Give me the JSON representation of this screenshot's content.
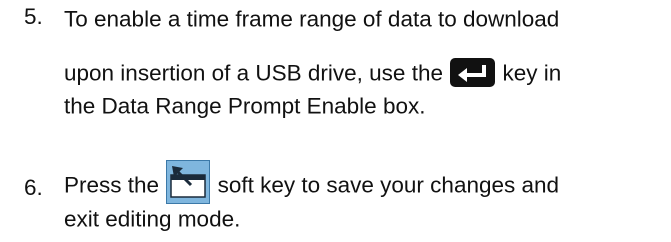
{
  "steps": [
    {
      "number": "5.",
      "line1": "To enable a time frame range of data to download",
      "line2_before": "upon insertion of a USB drive, use the",
      "line2_after": "key in",
      "line3": "the Data Range Prompt Enable box.",
      "icon": "enter-key-icon"
    },
    {
      "number": "6.",
      "line1_before": "Press the",
      "line1_after": "soft key to save your changes and",
      "line2": "exit editing mode.",
      "icon": "save-exit-soft-key-icon"
    }
  ]
}
